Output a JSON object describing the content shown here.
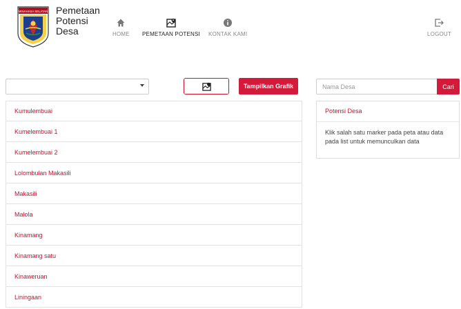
{
  "brand": {
    "logo_text": "MINAHASA SELATAN",
    "line1": "Pemetaan",
    "line2": "Potensi",
    "line3": "Desa"
  },
  "nav": {
    "home": "HOME",
    "pemetaan": "PEMETAAN POTENSI",
    "kontak": "KONTAK KAMI",
    "logout": "LOGOUT"
  },
  "toolbar": {
    "select_value": "",
    "grafik_label": "Tampilkan Grafik"
  },
  "desa_list": [
    "Kumulembuai",
    "Kumelembuai 1",
    "Kumelembuai 2",
    "Lolombulan Makasili",
    "Makasili",
    "Malola",
    "Kinamang",
    "Kinamang satu",
    "Kinaweruan",
    "Liningaan"
  ],
  "search": {
    "placeholder": "Nama Desa",
    "button_label": "Cari"
  },
  "panel": {
    "title": "Potensi Desa",
    "body": "Klik salah satu marker pada peta atau data pada list untuk memunculkan data"
  },
  "colors": {
    "accent": "#d41a3a",
    "link": "#c8102e"
  }
}
